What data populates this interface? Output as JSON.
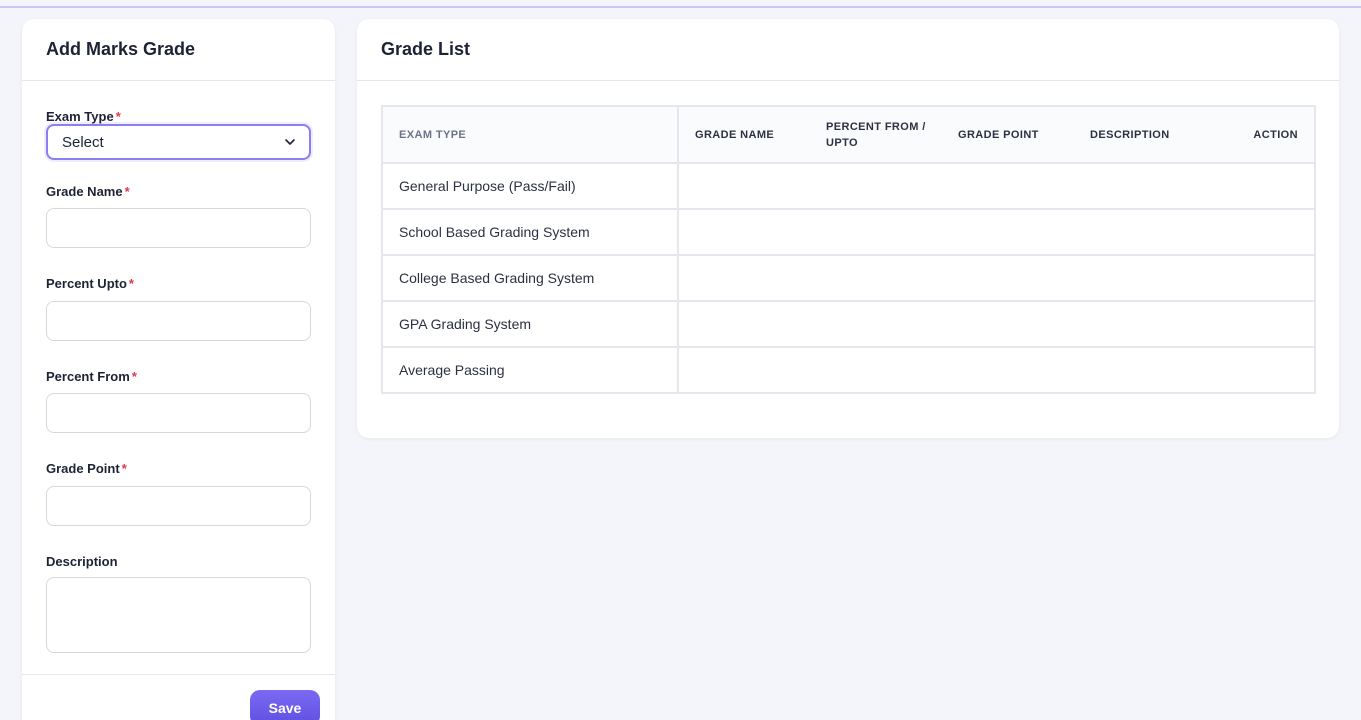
{
  "form": {
    "title": "Add Marks Grade",
    "required_mark": "*",
    "exam_type_label": "Exam Type",
    "exam_type_value": "Select",
    "grade_name_label": "Grade Name",
    "percent_upto_label": "Percent Upto",
    "percent_from_label": "Percent From",
    "grade_point_label": "Grade Point",
    "description_label": "Description",
    "save_label": "Save"
  },
  "grade_list": {
    "title": "Grade List",
    "columns": [
      "EXAM TYPE",
      "GRADE NAME",
      "PERCENT FROM / UPTO",
      "GRADE POINT",
      "DESCRIPTION",
      "ACTION"
    ],
    "rows": [
      {
        "exam_type": "General Purpose (Pass/Fail)"
      },
      {
        "exam_type": "School Based Grading System"
      },
      {
        "exam_type": "College Based Grading System"
      },
      {
        "exam_type": "GPA Grading System"
      },
      {
        "exam_type": "Average Passing"
      }
    ]
  },
  "colors": {
    "accent": "#6a5af0",
    "required": "#e0364f",
    "background": "#f4f5fa"
  }
}
